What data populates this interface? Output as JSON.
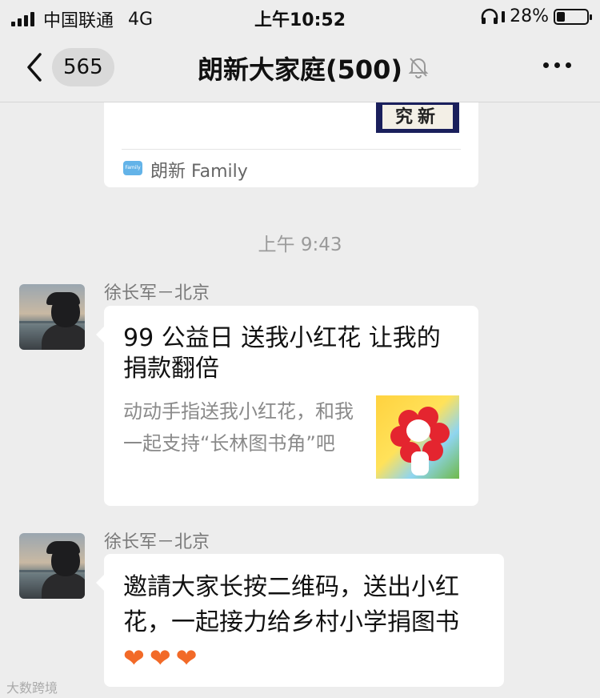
{
  "status_bar": {
    "carrier": "中国联通",
    "network": "4G",
    "time": "上午10:52",
    "battery": "28%",
    "battery_level": 0.28
  },
  "nav": {
    "unread_count": "565",
    "title": "朗新大家庭(500)"
  },
  "top_card": {
    "thumbnail_text": "究新",
    "source_icon_text": "Family",
    "source": "朗新 Family"
  },
  "timestamp": "上午 9:43",
  "messages": [
    {
      "sender": "徐长军－北京",
      "share_title": "99 公益日 送我小红花 让我的捐款翻倍",
      "share_desc": "动动手指送我小红花，和我一起支持“长林图书角”吧"
    },
    {
      "sender": "徐长军－北京",
      "text": "邀請大家长按二维码，送出小红花，一起接力给乡村小学捐图书",
      "emoji": [
        "❤",
        "❤",
        "❤"
      ]
    }
  ],
  "watermark": "大数跨境",
  "colors": {
    "background": "#ededed",
    "bubble": "#ffffff",
    "heart": "#f26a28"
  },
  "icons": [
    "signal-icon",
    "headphones-icon",
    "battery-icon",
    "back-chevron-icon",
    "mute-bell-icon",
    "more-dots-icon",
    "mini-program-icon"
  ]
}
